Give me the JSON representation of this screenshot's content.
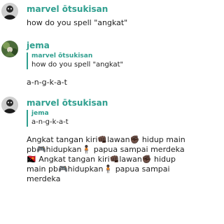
{
  "messages": [
    {
      "author": "marvel ōtsukisan",
      "text": "how do you spell \"angkat\""
    },
    {
      "author": "jema",
      "reply_to": {
        "author": "marvel ōtsukisan",
        "text": "how do you spell \"angkat\""
      },
      "text": "a-n-g-k-a-t"
    },
    {
      "author": "marvel ōtsukisan",
      "reply_to": {
        "author": "jema",
        "text": "a-n-g-k-a-t"
      },
      "text": "Angkat tangan kiri👊🏿lawan✊🏿 hidup main pb🎮hidupkan🧍🏿 papua sampai merdeka 🇵🇬 Angkat tangan kiri👊🏿lawan✊🏿 hidup main pb🎮hidupkan🧍🏿 papua sampai merdeka"
    }
  ]
}
